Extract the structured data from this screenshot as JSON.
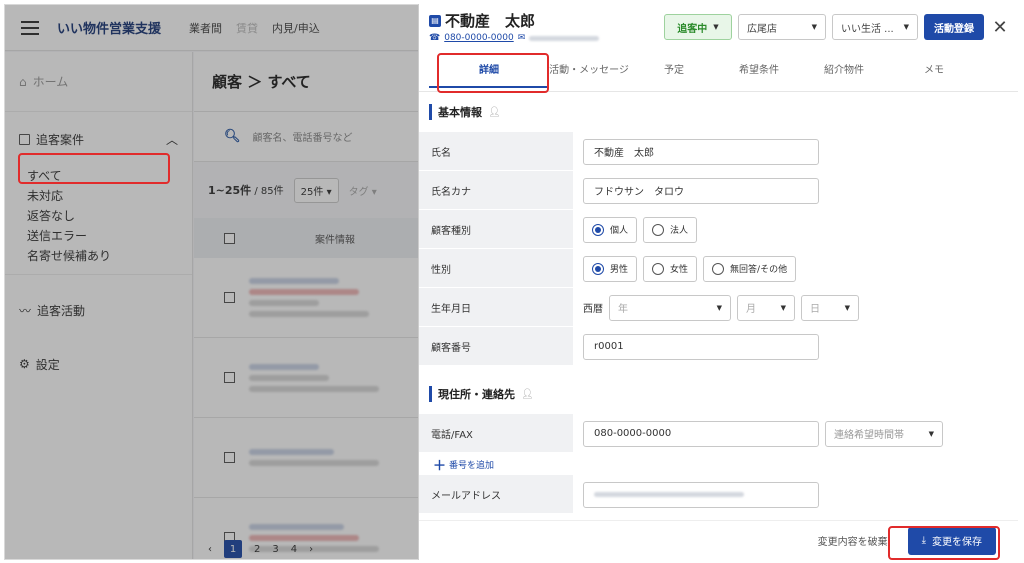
{
  "app": {
    "title": "いい物件営業支援",
    "nav": [
      "業者間",
      "賃貸",
      "内見/申込"
    ]
  },
  "sidebar": {
    "home": "ホーム",
    "tracking": "追客案件",
    "sub_items": [
      "すべて",
      "未対応",
      "返答なし",
      "送信エラー",
      "名寄せ候補あり"
    ],
    "activity": "追客活動",
    "settings": "設定"
  },
  "main": {
    "breadcrumb": "顧客 ＞ すべて",
    "search_placeholder": "顧客名、電話番号など",
    "count": "1~25件",
    "total": "/ 85件",
    "per_page": "25件",
    "tag_label": "タグ",
    "column_header": "案件情報",
    "pages": [
      "1",
      "2",
      "3",
      "4"
    ]
  },
  "panel": {
    "customer_name": "不動産　太郎",
    "phone": "080-0000-0000",
    "status": "追客中",
    "store": "広尾店",
    "channel": "いい生活 ...",
    "register_button": "活動登録",
    "tabs": [
      "詳細",
      "活動・メッセージ",
      "予定",
      "希望条件",
      "紹介物件",
      "メモ"
    ],
    "section_basic": "基本情報",
    "fields": {
      "name_label": "氏名",
      "name_value": "不動産　太郎",
      "kana_label": "氏名カナ",
      "kana_value": "フドウサン　タロウ",
      "type_label": "顧客種別",
      "type_options": [
        "個人",
        "法人"
      ],
      "gender_label": "性別",
      "gender_options": [
        "男性",
        "女性",
        "無回答/その他"
      ],
      "birth_label": "生年月日",
      "era": "西暦",
      "year_placeholder": "年",
      "month_placeholder": "月",
      "day_placeholder": "日",
      "number_label": "顧客番号",
      "number_value": "r0001"
    },
    "section_address": "現住所・連絡先",
    "contact": {
      "phone_label": "電話/FAX",
      "phone_value": "080-0000-0000",
      "contact_time": "連絡希望時間帯",
      "add_number": "番号を追加",
      "email_label": "メールアドレス"
    },
    "discard": "変更内容を破棄",
    "save": "変更を保存"
  },
  "colors": {
    "primary": "#1f4aa8",
    "status_green": "#2a8a2a",
    "highlight_red": "#e12b2b"
  }
}
